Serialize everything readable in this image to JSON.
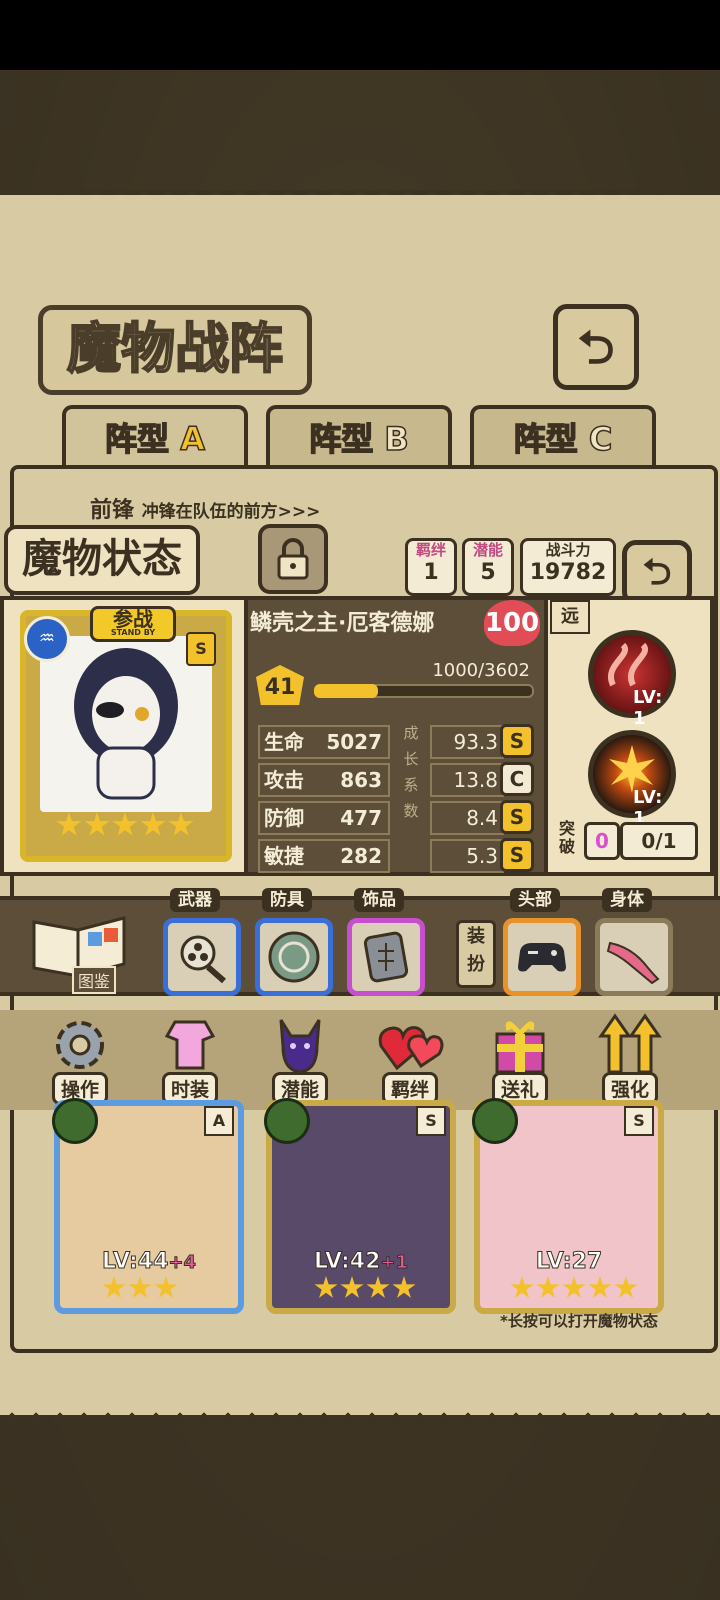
{
  "header": {
    "title": "魔物战阵",
    "back_icon": "back-arrow-icon"
  },
  "tabs": [
    {
      "label": "阵型",
      "letter": "A"
    },
    {
      "label": "阵型",
      "letter": "B"
    },
    {
      "label": "阵型",
      "letter": "C"
    }
  ],
  "formation": {
    "position": "前锋",
    "position_desc": "冲锋在队伍的前方>>>"
  },
  "status": {
    "title": "魔物状态",
    "bond": {
      "label": "羁绊",
      "value": "1"
    },
    "potential": {
      "label": "潜能",
      "value": "5"
    },
    "power": {
      "label": "战斗力",
      "value": "19782"
    }
  },
  "character": {
    "standby_label": "参战",
    "standby_sub": "STAND BY",
    "rank": "S",
    "stars": 5,
    "name": "鳞壳之主·厄客德娜",
    "affinity": "100",
    "level": "41",
    "exp": "1000/3602",
    "exp_fraction": 0.277,
    "range": "远",
    "stats": [
      {
        "label": "生命",
        "value": "5027",
        "growth": "93.3",
        "grade": "S"
      },
      {
        "label": "攻击",
        "value": "863",
        "growth": "13.8",
        "grade": "C"
      },
      {
        "label": "防御",
        "value": "477",
        "growth": "8.4",
        "grade": "S"
      },
      {
        "label": "敏捷",
        "value": "282",
        "growth": "5.3",
        "grade": "S"
      }
    ],
    "growth_label": [
      "成",
      "长",
      "系",
      "数"
    ],
    "skills": [
      {
        "level": "LV: 1"
      },
      {
        "level": "LV: 1"
      }
    ],
    "breakthrough": {
      "label": "突破",
      "count": "0",
      "progress": "0/1"
    }
  },
  "equipment": {
    "codex_label": "图鉴",
    "slots": [
      {
        "label": "武器",
        "icon": "gatling-gun-icon",
        "color": "#3a6fd8"
      },
      {
        "label": "防具",
        "icon": "emblem-shield-icon",
        "color": "#3a6fd8"
      },
      {
        "label": "饰品",
        "icon": "stone-tablet-icon",
        "color": "#c64fd0"
      }
    ],
    "outfit_label": "装扮",
    "outfit_slots": [
      {
        "label": "头部",
        "icon": "gamepad-icon",
        "color": "#e8922a"
      },
      {
        "label": "身体",
        "icon": "pink-scarf-icon",
        "color": "#8a7c5a"
      }
    ]
  },
  "actions": [
    {
      "label": "操作",
      "icon": "gear-icon"
    },
    {
      "label": "时装",
      "icon": "outfit-icon"
    },
    {
      "label": "潜能",
      "icon": "shadow-demon-icon"
    },
    {
      "label": "羁绊",
      "icon": "hearts-icon"
    },
    {
      "label": "送礼",
      "icon": "gift-box-icon"
    },
    {
      "label": "强化",
      "icon": "up-arrows-icon"
    }
  ],
  "team": [
    {
      "level": "LV:44",
      "plus": "+4",
      "rank": "A",
      "stars": 3,
      "color": "#5c9be0"
    },
    {
      "level": "LV:42",
      "plus": "+1",
      "rank": "S",
      "stars": 4,
      "color": "#c9aa46"
    },
    {
      "level": "LV:27",
      "plus": "",
      "rank": "S",
      "stars": 5,
      "color": "#c9aa46"
    }
  ],
  "hint": "*长按可以打开魔物状态"
}
